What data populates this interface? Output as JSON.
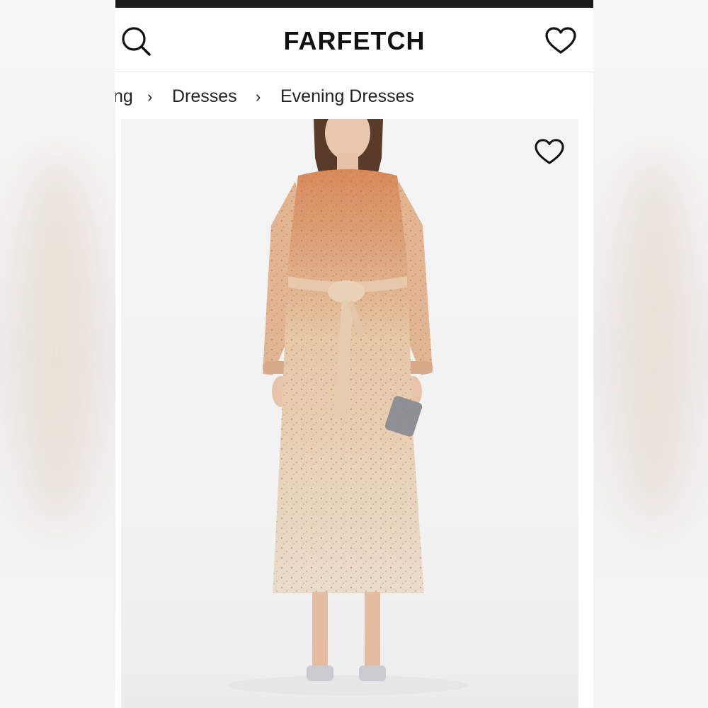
{
  "header": {
    "logo_text": "FARFETCH",
    "search_icon": "search-icon",
    "wishlist_icon": "heart-icon"
  },
  "breadcrumb": {
    "items": [
      {
        "label": "ng"
      },
      {
        "label": "Dresses"
      },
      {
        "label": "Evening Dresses"
      }
    ],
    "separator": "›"
  },
  "product": {
    "image_alt_icon": "product-image",
    "wishlist_icon": "heart-icon"
  },
  "colors": {
    "header_bg": "#ffffff",
    "status_bar": "#1a1a1a",
    "text": "#111111",
    "dress_gold": "#d9b48a",
    "dress_copper": "#c97a4a"
  }
}
